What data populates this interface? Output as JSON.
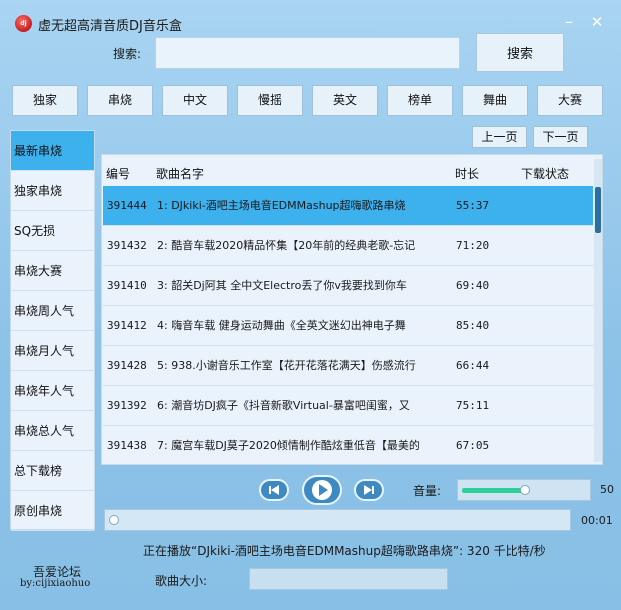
{
  "app": {
    "title": "虚无超高清音质DJ音乐盒",
    "logo_text": "dj"
  },
  "window": {
    "minimize": "–",
    "close": "✕"
  },
  "search": {
    "label": "搜索:",
    "value": "",
    "placeholder": "",
    "button": "搜索"
  },
  "categories": [
    "独家",
    "串烧",
    "中文",
    "慢摇",
    "英文",
    "榜单",
    "舞曲",
    "大赛"
  ],
  "sidebar": {
    "items": [
      "最新串烧",
      "独家串烧",
      "SQ无损",
      "串烧大赛",
      "串烧周人气",
      "串烧月人气",
      "串烧年人气",
      "串烧总人气",
      "总下载榜",
      "原创串烧"
    ],
    "active_index": 0
  },
  "pager": {
    "prev": "上一页",
    "next": "下一页"
  },
  "table": {
    "headers": {
      "id": "编号",
      "name": "歌曲名字",
      "duration": "时长",
      "status": "下载状态"
    },
    "rows": [
      {
        "id": "391444",
        "name": "1: DJkiki-酒吧主场电音EDMMashup超嗨歌路串烧",
        "duration": "55:37",
        "status": ""
      },
      {
        "id": "391432",
        "name": "2: 酷音车载2020精品怀集【20年前的经典老歌-忘记",
        "duration": "71:20",
        "status": ""
      },
      {
        "id": "391410",
        "name": "3: 韶关Dj阿其 全中文Electro丢了你v我要找到你车",
        "duration": "69:40",
        "status": ""
      },
      {
        "id": "391412",
        "name": "4: 嗨音车载 健身运动舞曲《全英文迷幻出神电子舞",
        "duration": "85:40",
        "status": ""
      },
      {
        "id": "391428",
        "name": "5: 938.小谢音乐工作室【花开花落花满天】伤感流行",
        "duration": "66:44",
        "status": ""
      },
      {
        "id": "391392",
        "name": "6: 潮音坊DJ疯子《抖音新歌Virtual-暴富吧闺蜜，又",
        "duration": "75:11",
        "status": ""
      },
      {
        "id": "391438",
        "name": "7: 魔宫车载DJ莫子2020倾情制作酷炫重低音【最美的",
        "duration": "67:05",
        "status": ""
      }
    ],
    "selected_index": 0
  },
  "player": {
    "volume_label": "音量:",
    "volume": 50,
    "volume_text": "50",
    "time": "00:01",
    "progress": 0.0,
    "now_playing": "正在播放“DJkiki-酒吧主场电音EDMMashup超嗨歌路串烧”: 320 千比特/秒"
  },
  "footer": {
    "forum": "吾爱论坛",
    "by": "by:cijixiaohuo",
    "size_label": "歌曲大小:",
    "size_value": ""
  },
  "colors": {
    "background": "#8ec3e8",
    "selection": "#3db0ee",
    "control": "#3f89c3",
    "volume_fill": "#2ed09a"
  }
}
